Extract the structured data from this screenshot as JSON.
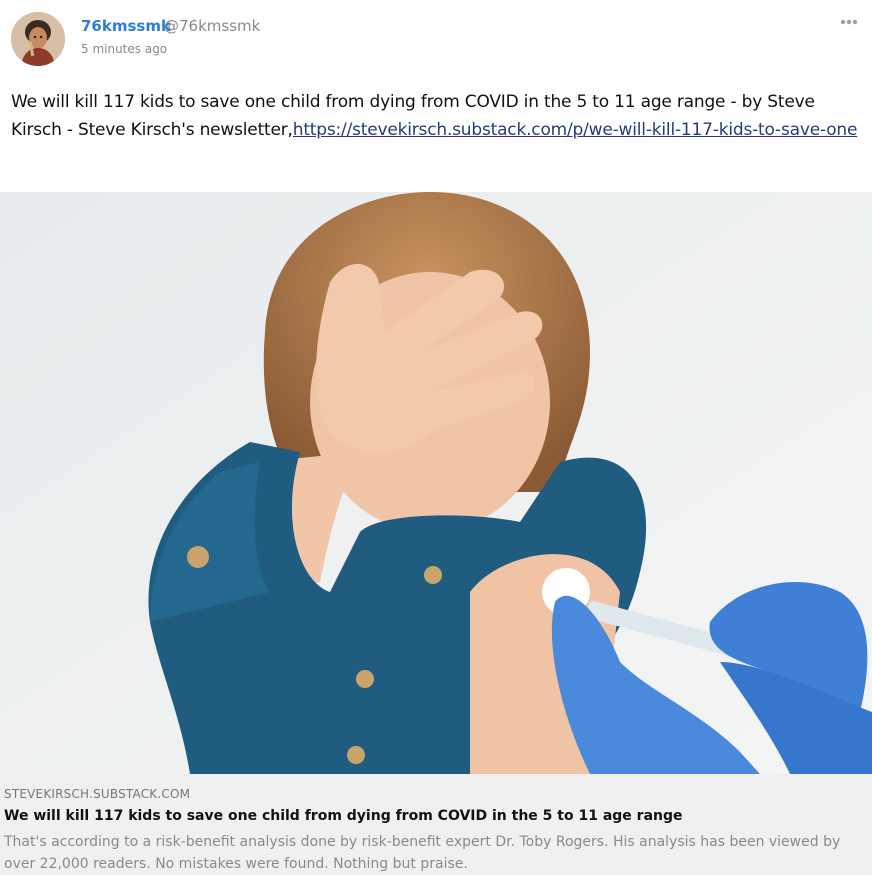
{
  "author": {
    "display_name": "76kmssmk",
    "handle": "@76kmssmk",
    "time": "5 minutes ago"
  },
  "status": {
    "text": "We will kill 117 kids to save one child from dying from COVID in the 5 to 11 age range - by Steve Kirsch - Steve Kirsch's newsletter,",
    "link": "https://stevekirsch.substack.com/p/we-will-kill-117-kids-to-save-one"
  },
  "card": {
    "domain": "STEVEKIRSCH.SUBSTACK.COM",
    "title": "We will kill 117 kids to save one child from dying from COVID in the 5 to 11 age range",
    "description": "That's according to a risk-benefit analysis done by risk-benefit expert Dr. Toby Rogers. His analysis has been viewed by over 22,000 readers. No mistakes were found. Nothing but praise."
  },
  "icons": {
    "more": "more-horizontal-icon",
    "avatar": "avatar-portrait"
  },
  "colors": {
    "author_name": "#2c7fd8",
    "link": "#283a7a",
    "card_background": "#f0f0f0",
    "muted_text": "#8a8a8a"
  }
}
